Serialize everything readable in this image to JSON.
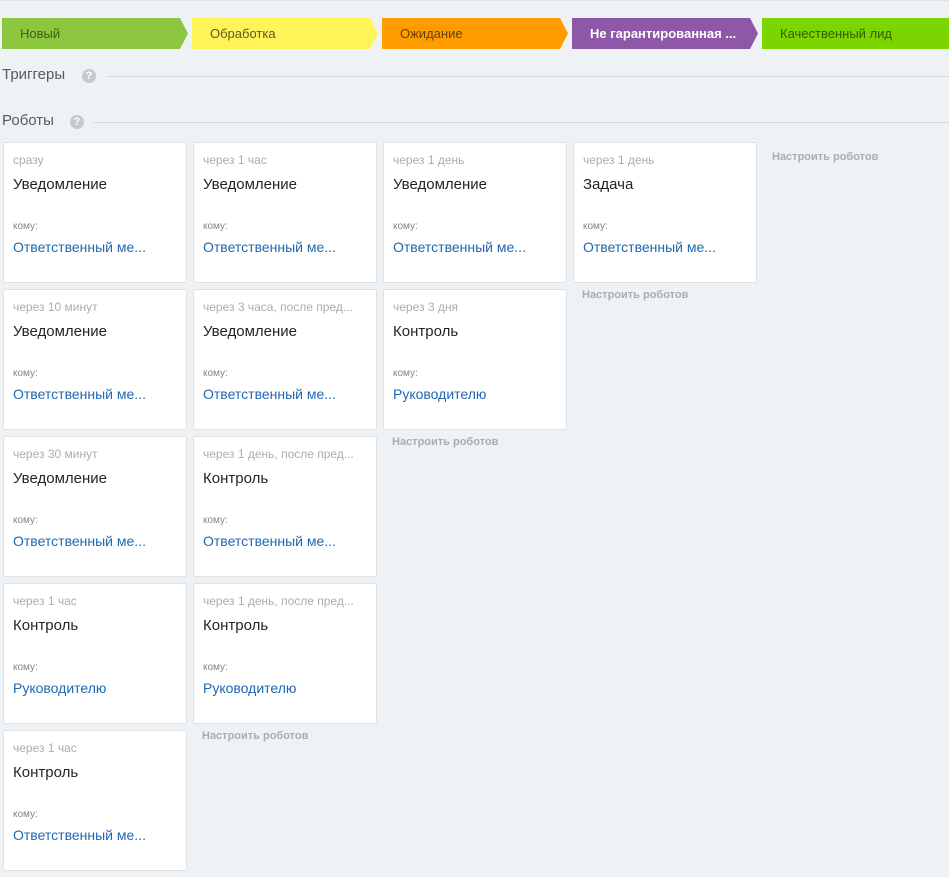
{
  "stages": [
    {
      "label": "Новый",
      "bg": "#8dc63f",
      "color": "#3f5f17"
    },
    {
      "label": "Обработка",
      "bg": "#fff55a",
      "color": "#5e5a17"
    },
    {
      "label": "Ожидание",
      "bg": "#ff9c00",
      "color": "#6b3f00"
    },
    {
      "label": "Не гарантированная ...",
      "bg": "#8e57a8",
      "color": "#ffffff"
    },
    {
      "label": "Качественный лид",
      "bg": "#7bd500",
      "color": "#355b00"
    }
  ],
  "triggers": {
    "title": "Триггеры",
    "help": "?"
  },
  "robots": {
    "title": "Роботы",
    "help": "?"
  },
  "columns": [
    {
      "cards": [
        {
          "delay": "сразу",
          "title": "Уведомление",
          "to_label": "кому:",
          "to_value": "Ответственный ме..."
        },
        {
          "delay": "через 10 минут",
          "title": "Уведомление",
          "to_label": "кому:",
          "to_value": "Ответственный ме..."
        },
        {
          "delay": "через 30 минут",
          "title": "Уведомление",
          "to_label": "кому:",
          "to_value": "Ответственный ме..."
        },
        {
          "delay": "через 1 час",
          "title": "Контроль",
          "to_label": "кому:",
          "to_value": "Руководителю"
        },
        {
          "delay": "через 1 час",
          "title": "Контроль",
          "to_label": "кому:",
          "to_value": "Ответственный ме..."
        }
      ],
      "setup": ""
    },
    {
      "cards": [
        {
          "delay": "через 1 час",
          "title": "Уведомление",
          "to_label": "кому:",
          "to_value": "Ответственный ме..."
        },
        {
          "delay": "через 3 часа, после пред...",
          "title": "Уведомление",
          "to_label": "кому:",
          "to_value": "Ответственный ме..."
        },
        {
          "delay": "через 1 день, после пред...",
          "title": "Контроль",
          "to_label": "кому:",
          "to_value": "Ответственный ме..."
        },
        {
          "delay": "через 1 день, после пред...",
          "title": "Контроль",
          "to_label": "кому:",
          "to_value": "Руководителю"
        }
      ],
      "setup": "Настроить роботов"
    },
    {
      "cards": [
        {
          "delay": "через 1 день",
          "title": "Уведомление",
          "to_label": "кому:",
          "to_value": "Ответственный ме..."
        },
        {
          "delay": "через 3 дня",
          "title": "Контроль",
          "to_label": "кому:",
          "to_value": "Руководителю"
        }
      ],
      "setup": "Настроить роботов"
    },
    {
      "cards": [
        {
          "delay": "через 1 день",
          "title": "Задача",
          "to_label": "кому:",
          "to_value": "Ответственный ме..."
        }
      ],
      "setup": "Настроить роботов"
    },
    {
      "cards": [],
      "setup": "Настроить роботов"
    }
  ]
}
